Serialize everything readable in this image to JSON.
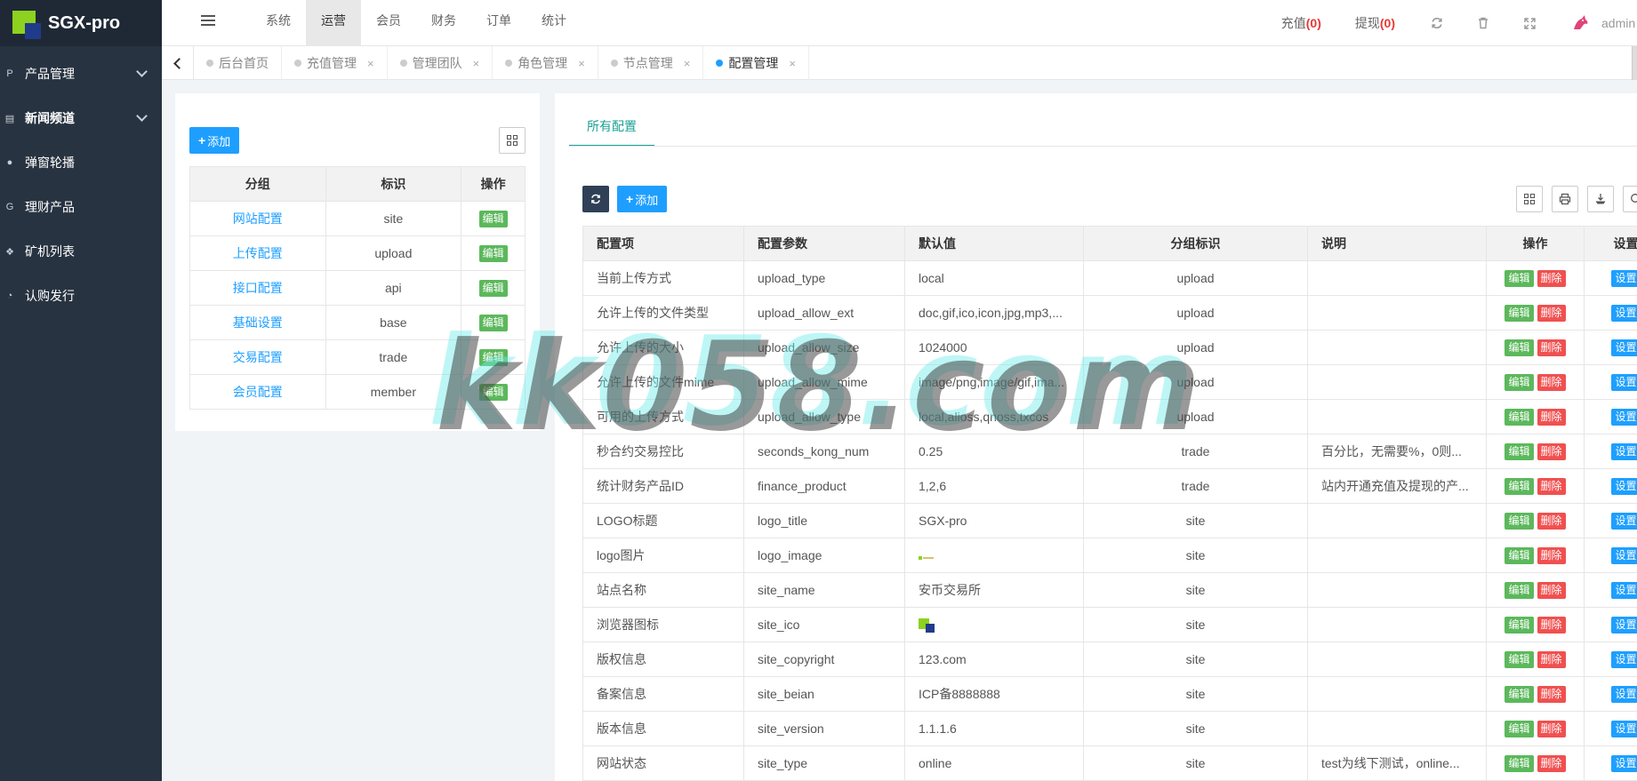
{
  "app": {
    "title": "SGX-pro"
  },
  "sidebar": {
    "items": [
      {
        "label": "产品管理",
        "icon": "p-circle-icon",
        "glyph": "P",
        "has_children": true
      },
      {
        "label": "新闻频道",
        "icon": "newspaper-icon",
        "glyph": "▤",
        "has_children": true
      },
      {
        "label": "弹窗轮播",
        "icon": "disc-icon",
        "glyph": "●",
        "has_children": false
      },
      {
        "label": "理财产品",
        "icon": "g-letter-icon",
        "glyph": "G",
        "has_children": false
      },
      {
        "label": "矿机列表",
        "icon": "cubes-icon",
        "glyph": "❖",
        "has_children": false
      },
      {
        "label": "认购发行",
        "icon": "pie-chart-icon",
        "glyph": "◔",
        "has_children": false
      }
    ]
  },
  "topnav": {
    "items": [
      "系统",
      "运营",
      "会员",
      "财务",
      "订单",
      "统计"
    ],
    "active": "运营"
  },
  "topright": {
    "recharge_label": "充值",
    "recharge_count": "(0)",
    "withdraw_label": "提现",
    "withdraw_count": "(0)",
    "admin_name": "admin"
  },
  "tabs": [
    {
      "label": "后台首页",
      "closable": false,
      "active": false
    },
    {
      "label": "充值管理",
      "closable": true,
      "active": false
    },
    {
      "label": "管理团队",
      "closable": true,
      "active": false
    },
    {
      "label": "角色管理",
      "closable": true,
      "active": false
    },
    {
      "label": "节点管理",
      "closable": true,
      "active": false
    },
    {
      "label": "配置管理",
      "closable": true,
      "active": true
    }
  ],
  "tab_close_glyph": "×",
  "left_panel": {
    "add_label": "添加",
    "columns": [
      "分组",
      "标识",
      "操作"
    ],
    "edit_label": "编辑",
    "rows": [
      {
        "group": "网站配置",
        "ident": "site"
      },
      {
        "group": "上传配置",
        "ident": "upload"
      },
      {
        "group": "接口配置",
        "ident": "api"
      },
      {
        "group": "基础设置",
        "ident": "base"
      },
      {
        "group": "交易配置",
        "ident": "trade"
      },
      {
        "group": "会员配置",
        "ident": "member"
      }
    ]
  },
  "right_panel": {
    "tab_label": "所有配置",
    "add_label": "添加",
    "columns": [
      "配置项",
      "配置参数",
      "默认值",
      "分组标识",
      "说明",
      "操作",
      "设置"
    ],
    "edit_label": "编辑",
    "delete_label": "删除",
    "set_label": "设置",
    "rows": [
      {
        "item": "当前上传方式",
        "param": "upload_type",
        "value": "local",
        "group": "upload",
        "desc": ""
      },
      {
        "item": "允许上传的文件类型",
        "param": "upload_allow_ext",
        "value": "doc,gif,ico,icon,jpg,mp3,...",
        "group": "upload",
        "desc": ""
      },
      {
        "item": "允许上传的大小",
        "param": "upload_allow_size",
        "value": "1024000",
        "group": "upload",
        "desc": ""
      },
      {
        "item": "允许上传的文件mime",
        "param": "upload_allow_mime",
        "value": "image/png,image/gif,ima...",
        "group": "upload",
        "desc": ""
      },
      {
        "item": "可用的上传方式",
        "param": "upload_allow_type",
        "value": "local,alioss,qnoss,txcos",
        "group": "upload",
        "desc": ""
      },
      {
        "item": "秒合约交易控比",
        "param": "seconds_kong_num",
        "value": "0.25",
        "group": "trade",
        "desc": "百分比，无需要%，0则..."
      },
      {
        "item": "统计财务产品ID",
        "param": "finance_product",
        "value": "1,2,6",
        "group": "trade",
        "desc": "站内开通充值及提现的产..."
      },
      {
        "item": "LOGO标题",
        "param": "logo_title",
        "value": "SGX-pro",
        "group": "site",
        "desc": ""
      },
      {
        "item": "logo图片",
        "param": "logo_image",
        "value": "",
        "value_image": "small-logo",
        "group": "site",
        "desc": ""
      },
      {
        "item": "站点名称",
        "param": "site_name",
        "value": "安币交易所",
        "group": "site",
        "desc": ""
      },
      {
        "item": "浏览器图标",
        "param": "site_ico",
        "value": "",
        "value_image": "favicon",
        "group": "site",
        "desc": ""
      },
      {
        "item": "版权信息",
        "param": "site_copyright",
        "value": "123.com",
        "group": "site",
        "desc": ""
      },
      {
        "item": "备案信息",
        "param": "site_beian",
        "value": "ICP备8888888",
        "group": "site",
        "desc": ""
      },
      {
        "item": "版本信息",
        "param": "site_version",
        "value": "1.1.1.6",
        "group": "site",
        "desc": ""
      },
      {
        "item": "网站状态",
        "param": "site_type",
        "value": "online",
        "group": "site",
        "desc": "test为线下测试，online..."
      }
    ]
  },
  "watermark": "kk058.com",
  "colors": {
    "sidebar_bg": "#283341",
    "primary": "#1e9fff",
    "edit": "#5cb85c",
    "delete": "#f05050",
    "active_tab": "#1aa094",
    "count_red": "#e53935"
  }
}
